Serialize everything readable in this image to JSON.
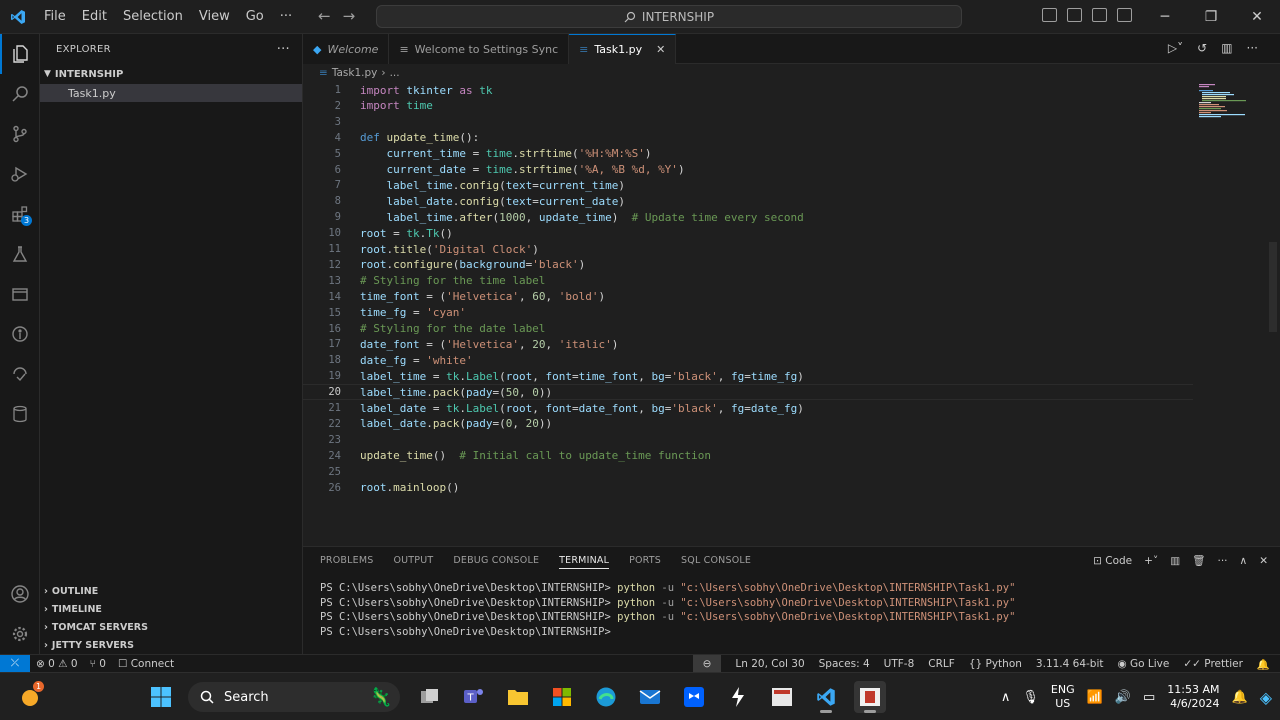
{
  "titlebar": {
    "menu": [
      "File",
      "Edit",
      "Selection",
      "View",
      "Go",
      "···"
    ],
    "command_center": "INTERNSHIP"
  },
  "sidebar": {
    "title": "EXPLORER",
    "more": "···",
    "folder": "INTERNSHIP",
    "files": [
      "Task1.py"
    ],
    "sections": [
      "OUTLINE",
      "TIMELINE",
      "TOMCAT SERVERS",
      "JETTY SERVERS"
    ]
  },
  "activitybar": {
    "extensions_badge": "3"
  },
  "tabs": [
    {
      "label": "Welcome",
      "italic": true
    },
    {
      "label": "Welcome to Settings Sync",
      "italic": false
    },
    {
      "label": "Task1.py",
      "italic": false,
      "active": true
    }
  ],
  "breadcrumb": [
    "Task1.py",
    "..."
  ],
  "editor": {
    "current_line": 20,
    "lines": [
      {
        "n": "1",
        "code": "import tkinter as tk"
      },
      {
        "n": "2",
        "code": "import time"
      },
      {
        "n": "3",
        "code": ""
      },
      {
        "n": "4",
        "code": "def update_time():"
      },
      {
        "n": "5",
        "code": "    current_time = time.strftime('%H:%M:%S')"
      },
      {
        "n": "6",
        "code": "    current_date = time.strftime('%A, %B %d, %Y')"
      },
      {
        "n": "7",
        "code": "    label_time.config(text=current_time)"
      },
      {
        "n": "8",
        "code": "    label_date.config(text=current_date)"
      },
      {
        "n": "9",
        "code": "    label_time.after(1000, update_time)  # Update time every second"
      },
      {
        "n": "10",
        "code": "root = tk.Tk()"
      },
      {
        "n": "11",
        "code": "root.title('Digital Clock')"
      },
      {
        "n": "12",
        "code": "root.configure(background='black')"
      },
      {
        "n": "13",
        "code": "# Styling for the time label"
      },
      {
        "n": "14",
        "code": "time_font = ('Helvetica', 60, 'bold')"
      },
      {
        "n": "15",
        "code": "time_fg = 'cyan'"
      },
      {
        "n": "16",
        "code": "# Styling for the date label"
      },
      {
        "n": "17",
        "code": "date_font = ('Helvetica', 20, 'italic')"
      },
      {
        "n": "18",
        "code": "date_fg = 'white'"
      },
      {
        "n": "19",
        "code": "label_time = tk.Label(root, font=time_font, bg='black', fg=time_fg)"
      },
      {
        "n": "20",
        "code": "label_time.pack(pady=(50, 0))"
      },
      {
        "n": "21",
        "code": "label_date = tk.Label(root, font=date_font, bg='black', fg=date_fg)"
      },
      {
        "n": "22",
        "code": "label_date.pack(pady=(0, 20))"
      },
      {
        "n": "23",
        "code": ""
      },
      {
        "n": "24",
        "code": "update_time()  # Initial call to update_time function"
      },
      {
        "n": "25",
        "code": ""
      },
      {
        "n": "26",
        "code": "root.mainloop()"
      }
    ]
  },
  "panel": {
    "tabs": [
      "PROBLEMS",
      "OUTPUT",
      "DEBUG CONSOLE",
      "TERMINAL",
      "PORTS",
      "SQL CONSOLE"
    ],
    "active_tab": "TERMINAL",
    "terminal_profile": "Code",
    "terminal": [
      {
        "prompt": "PS C:\\Users\\sobhy\\OneDrive\\Desktop\\INTERNSHIP> ",
        "cmd": "python",
        "flag": " -u ",
        "path": "\"c:\\Users\\sobhy\\OneDrive\\Desktop\\INTERNSHIP\\Task1.py\""
      },
      {
        "prompt": "PS C:\\Users\\sobhy\\OneDrive\\Desktop\\INTERNSHIP> ",
        "cmd": "python",
        "flag": " -u ",
        "path": "\"c:\\Users\\sobhy\\OneDrive\\Desktop\\INTERNSHIP\\Task1.py\""
      },
      {
        "prompt": "PS C:\\Users\\sobhy\\OneDrive\\Desktop\\INTERNSHIP> ",
        "cmd": "python",
        "flag": " -u ",
        "path": "\"c:\\Users\\sobhy\\OneDrive\\Desktop\\INTERNSHIP\\Task1.py\""
      },
      {
        "prompt": "PS C:\\Users\\sobhy\\OneDrive\\Desktop\\INTERNSHIP> ",
        "cmd": "",
        "flag": "",
        "path": ""
      }
    ]
  },
  "statusbar": {
    "errors": "0",
    "warnings": "0",
    "ports": "0",
    "connect": "Connect",
    "position": "Ln 20, Col 30",
    "spaces": "Spaces: 4",
    "encoding": "UTF-8",
    "eol": "CRLF",
    "language": "Python",
    "interpreter": "3.11.4 64-bit",
    "golive": "Go Live",
    "prettier": "Prettier"
  },
  "taskbar": {
    "search": "Search",
    "lang_top": "ENG",
    "lang_bottom": "US",
    "time": "11:53 AM",
    "date": "4/6/2024",
    "notification_badge": "1"
  },
  "colors": {
    "accent": "#0078d4",
    "editor_bg": "#1f1f1f",
    "sidebar_bg": "#181818"
  }
}
